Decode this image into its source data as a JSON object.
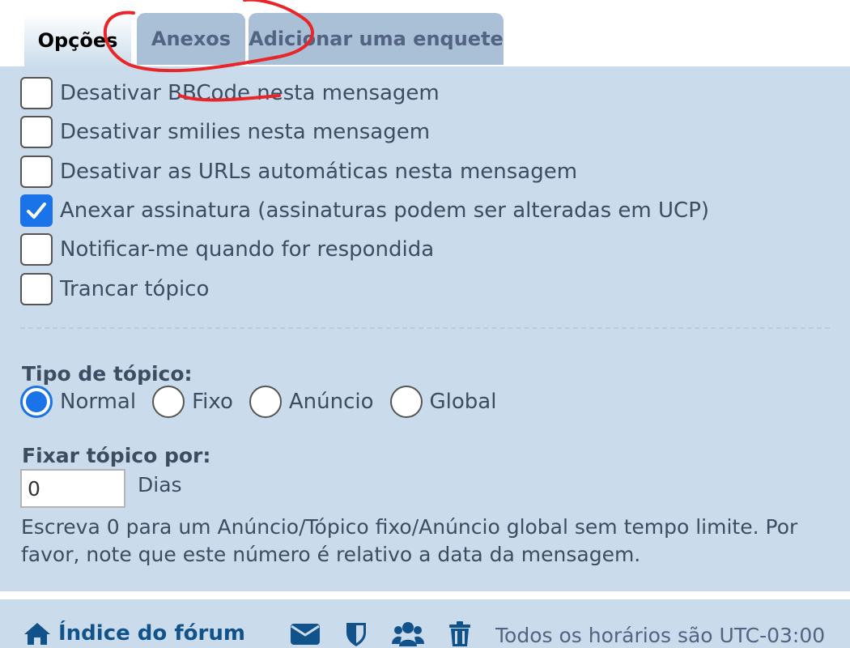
{
  "tabs": [
    {
      "label": "Opções",
      "active": true
    },
    {
      "label": "Anexos",
      "active": false
    },
    {
      "label": "Adicionar uma enquete",
      "active": false
    }
  ],
  "options": [
    {
      "label": "Desativar BBCode nesta mensagem",
      "checked": false
    },
    {
      "label": "Desativar smilies nesta mensagem",
      "checked": false
    },
    {
      "label": "Desativar as URLs automáticas nesta mensagem",
      "checked": false
    },
    {
      "label": "Anexar assinatura (assinaturas podem ser alteradas em UCP)",
      "checked": true
    },
    {
      "label": "Notificar-me quando for respondida",
      "checked": false
    },
    {
      "label": "Trancar tópico",
      "checked": false
    }
  ],
  "topic_type": {
    "label": "Tipo de tópico:",
    "options": [
      "Normal",
      "Fixo",
      "Anúncio",
      "Global"
    ],
    "selected": "Normal"
  },
  "stick_for": {
    "label": "Fixar tópico por:",
    "value": "0",
    "unit": "Dias",
    "explain": "Escreva 0 para um Anúncio/Tópico fixo/Anúncio global sem tempo limite. Por favor, note que este número é relativo a data da mensagem."
  },
  "footer": {
    "home_label": "Índice do fórum",
    "icons": [
      "envelope-icon",
      "shield-icon",
      "users-icon",
      "trash-icon"
    ],
    "timezone": "Todos os horários são UTC-03:00"
  },
  "colors": {
    "panel": "#cadceb",
    "accent": "#1a73e8",
    "link": "#105289",
    "annotation": "#e8262a"
  }
}
